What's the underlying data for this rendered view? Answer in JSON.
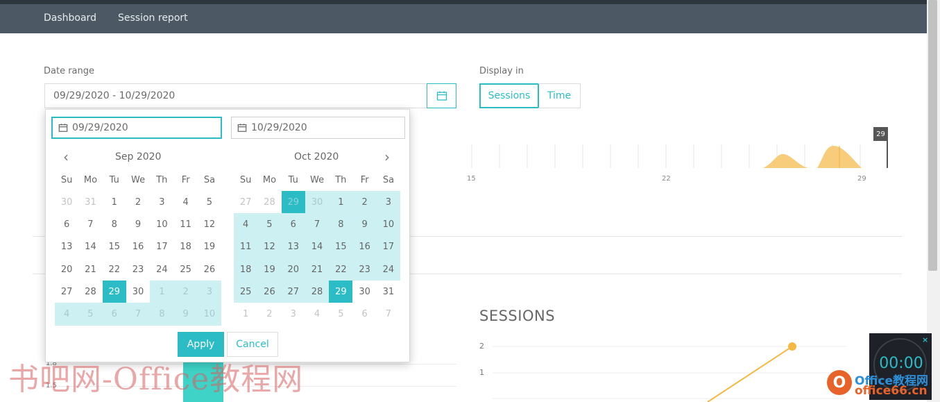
{
  "nav": {
    "dashboard": "Dashboard",
    "session_report": "Session report"
  },
  "date_range": {
    "label": "Date range",
    "value": "09/29/2020 - 10/29/2020"
  },
  "display_in": {
    "label": "Display in",
    "options": [
      "Sessions",
      "Time"
    ],
    "selected": "Sessions"
  },
  "timeline": {
    "labels": [
      "15",
      "22",
      "29"
    ],
    "marker": "29"
  },
  "sessions_chart": {
    "title": "SESSIONS",
    "y_ticks": [
      "2",
      "1"
    ]
  },
  "left_chart": {
    "y_ticks": [
      "1.8",
      "1.5"
    ]
  },
  "picker": {
    "start_date": "09/29/2020",
    "end_date": "10/29/2020",
    "left_month": "Sep 2020",
    "right_month": "Oct 2020",
    "weekdays": [
      "Su",
      "Mo",
      "Tu",
      "We",
      "Th",
      "Fr",
      "Sa"
    ],
    "left_days": [
      [
        "30",
        "31",
        "1",
        "2",
        "3",
        "4",
        "5"
      ],
      [
        "6",
        "7",
        "8",
        "9",
        "10",
        "11",
        "12"
      ],
      [
        "13",
        "14",
        "15",
        "16",
        "17",
        "18",
        "19"
      ],
      [
        "20",
        "21",
        "22",
        "23",
        "24",
        "25",
        "26"
      ],
      [
        "27",
        "28",
        "29",
        "30",
        "1",
        "2",
        "3"
      ],
      [
        "4",
        "5",
        "6",
        "7",
        "8",
        "9",
        "10"
      ]
    ],
    "right_days": [
      [
        "27",
        "28",
        "29",
        "30",
        "1",
        "2",
        "3"
      ],
      [
        "4",
        "5",
        "6",
        "7",
        "8",
        "9",
        "10"
      ],
      [
        "11",
        "12",
        "13",
        "14",
        "15",
        "16",
        "17"
      ],
      [
        "18",
        "19",
        "20",
        "21",
        "22",
        "23",
        "24"
      ],
      [
        "25",
        "26",
        "27",
        "28",
        "29",
        "30",
        "31"
      ],
      [
        "1",
        "2",
        "3",
        "4",
        "5",
        "6",
        "7"
      ]
    ],
    "apply": "Apply",
    "cancel": "Cancel"
  },
  "timer": {
    "value": "00:00",
    "close": "×"
  },
  "watermark": {
    "cn": "书吧网-Office教程网",
    "logo": "O",
    "line1": "Office教程网",
    "line2": "office66.cn"
  },
  "colors": {
    "accent": "#2cbcc6",
    "range": "#cdf0f2",
    "nav": "#4c5964",
    "chart_line": "#f4b942"
  }
}
